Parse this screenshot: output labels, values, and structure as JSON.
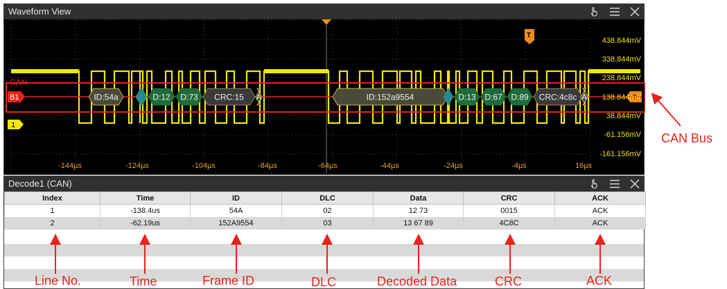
{
  "waveform_window": {
    "title": "Waveform View",
    "trigger_badge": "T",
    "channel_labels": {
      "bus": "B1",
      "can": "CAN",
      "analog": "1"
    },
    "voltage_labels": [
      "438.844mV",
      "338.844mV",
      "238.844mV",
      "138.844mV",
      "38.844mV",
      "-61.156mV",
      "-161.156mV"
    ],
    "time_labels": [
      "-144µs",
      "-124µs",
      "-104µs",
      "-84µs",
      "-64µs",
      "-44µs",
      "-24µs",
      "-4µs",
      "16µs"
    ],
    "decode_segments": [
      "ID:54a",
      "D:12",
      "D:73",
      "CRC:15",
      "A",
      "ID:152a9554",
      "D:13",
      "D:67",
      "D:89",
      "CRC:4c8c",
      "A"
    ],
    "colors": {
      "trace": "#f2e60a",
      "bus_box": "#e8231b",
      "trigger": "#f08c1e",
      "label_green": "#1f6b3a"
    }
  },
  "decode_window": {
    "title": "Decode1 (CAN)",
    "columns": [
      "Index",
      "Time",
      "ID",
      "DLC",
      "Data",
      "CRC",
      "ACK"
    ],
    "rows": [
      [
        "1",
        "-138.4us",
        "54A",
        "02",
        "12 73",
        "0015",
        "ACK"
      ],
      [
        "2",
        "-62.19us",
        "152A9554",
        "03",
        "13 67 89",
        "4C8C",
        "ACK"
      ]
    ]
  },
  "annotations": {
    "can_bus": "CAN Bus",
    "line_no": "Line No.",
    "time": "Time",
    "frame_id": "Frame ID",
    "dlc": "DLC",
    "decoded_data": "Decoded Data",
    "crc": "CRC",
    "ack": "ACK"
  }
}
